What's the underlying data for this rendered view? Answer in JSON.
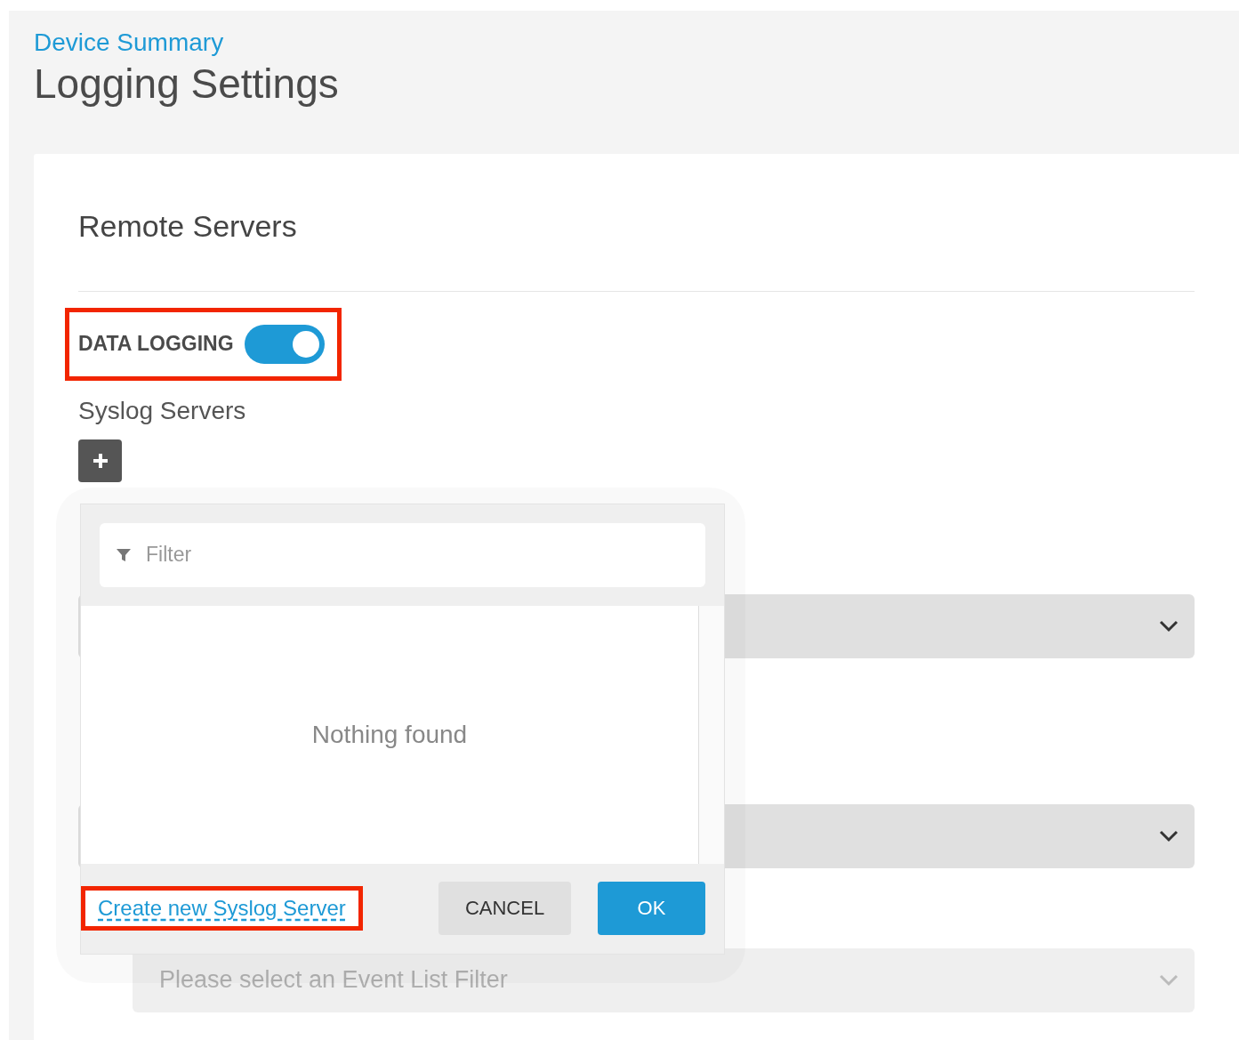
{
  "breadcrumb": "Device Summary",
  "title": "Logging Settings",
  "section": {
    "title": "Remote Servers",
    "data_logging": {
      "label": "DATA LOGGING",
      "on": true
    },
    "syslog_label": "Syslog Servers",
    "selects": [
      {
        "disabled": false,
        "indented": false
      },
      {
        "disabled": false,
        "indented": false
      },
      {
        "disabled": true,
        "indented": true,
        "placeholder": "Please select an Event List Filter"
      }
    ]
  },
  "popup": {
    "filter_placeholder": "Filter",
    "empty_text": "Nothing found",
    "create_link": "Create new Syslog Server",
    "buttons": [
      {
        "label": "CANCEL",
        "kind": "secondary"
      },
      {
        "label": "OK",
        "kind": "primary"
      }
    ]
  }
}
